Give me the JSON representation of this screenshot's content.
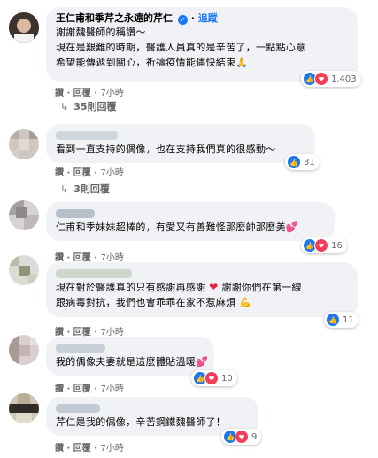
{
  "comments": [
    {
      "name": "王仁甫和季芹之永遠的芹仁",
      "verified": true,
      "follow_label": "追蹤",
      "lines": [
        "謝謝魏醫師的稱讚～",
        "現在是艱難的時期，醫護人員真的是辛苦了，一點點心意",
        "希望能傳遞到關心，祈禱疫情能儘快結束"
      ],
      "trail_emoji": "🙏",
      "like_label": "讚",
      "reply_label": "回覆",
      "time": "7小時",
      "reaction_count": "1,403",
      "replies_label": "35則回覆"
    },
    {
      "name": "",
      "lines": [
        "看到一直支持的偶像，也在支持我們真的很感動～"
      ],
      "like_label": "讚",
      "reply_label": "回覆",
      "time": "7小時",
      "reaction_count": "31",
      "replies_label": "3則回覆"
    },
    {
      "name": "",
      "lines": [
        "仁甫和季妹妹超棒的，有愛又有善難怪那麼帥那麼美"
      ],
      "trail_emoji": "💕",
      "like_label": "讚",
      "reply_label": "回覆",
      "time": "7小時",
      "reaction_count": "16"
    },
    {
      "name": "",
      "lines": [
        "現在對於醫護真的只有感謝再感謝",
        "謝謝你們在第一線",
        "跟病毒對抗，我們也會乖乖在家不惹麻煩"
      ],
      "mid_emoji": "❤",
      "trail_emoji": "💪",
      "like_label": "讚",
      "reply_label": "回覆",
      "time": "7小時",
      "reaction_count": "11"
    },
    {
      "name": "",
      "lines": [
        "我的偶像夫妻就是這麼體貼溫暖"
      ],
      "trail_emoji": "💕",
      "like_label": "讚",
      "reply_label": "回覆",
      "time": "7小時",
      "reaction_count": "10"
    },
    {
      "name": "",
      "lines": [
        "芹仁是我的偶像，辛苦鋼鐵魏醫師了！"
      ],
      "like_label": "讚",
      "reply_label": "回覆",
      "time": "7小時",
      "reaction_count": "9"
    }
  ],
  "colors": {
    "bubble": "#f0f2f5",
    "link": "#1877f2",
    "meta": "#65676b",
    "like": "#1877f2",
    "love": "#f33e58"
  }
}
